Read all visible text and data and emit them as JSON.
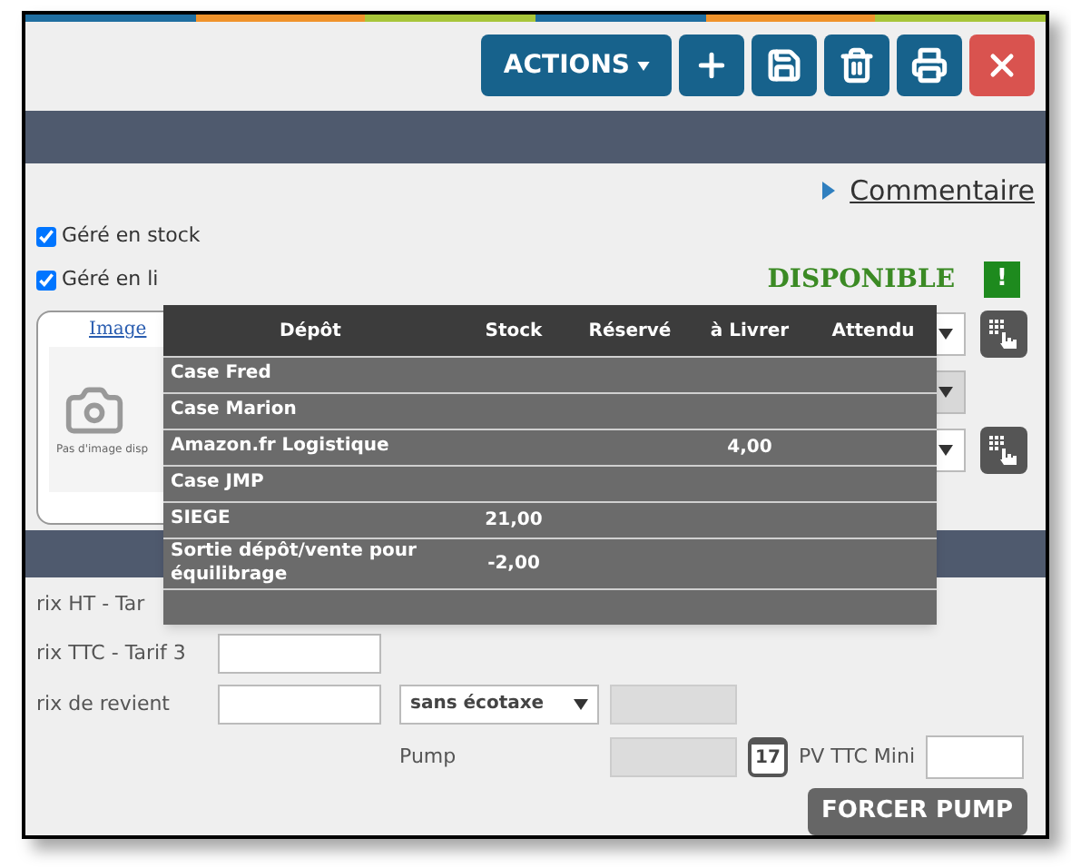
{
  "toolbar": {
    "actions_label": "ACTIONS",
    "buttons": [
      {
        "kind": "add"
      },
      {
        "kind": "save"
      },
      {
        "kind": "delete"
      },
      {
        "kind": "print"
      },
      {
        "kind": "close"
      }
    ]
  },
  "comment_link": "Commentaire",
  "checkboxes": [
    {
      "label": "Géré en stock",
      "checked": true
    },
    {
      "label": "Géré en li",
      "checked": true
    }
  ],
  "status": {
    "label": "DISPONIBLE",
    "alert": "!"
  },
  "image": {
    "link": "Image",
    "caption": "Pas d'image disp"
  },
  "selectors": [
    {
      "disabled": false
    },
    {
      "disabled": true
    },
    {
      "disabled": false
    }
  ],
  "stock_table": {
    "columns": [
      "Dépôt",
      "Stock",
      "Réservé",
      "à Livrer",
      "Attendu"
    ],
    "rows": [
      [
        "Case Fred",
        "",
        "",
        "",
        ""
      ],
      [
        "Case Marion",
        "",
        "",
        "",
        ""
      ],
      [
        "Amazon.fr Logistique",
        "",
        "",
        "4,00",
        ""
      ],
      [
        "Case JMP",
        "",
        "",
        "",
        ""
      ],
      [
        "SIEGE",
        "21,00",
        "",
        "",
        ""
      ],
      [
        "Sortie dépôt/vente pour équilibrage",
        "-2,00",
        "",
        "",
        ""
      ],
      [
        "",
        "",
        "",
        "",
        ""
      ]
    ]
  },
  "price_form": {
    "ht_label": "rix HT - Tar",
    "ttc_label": "rix TTC - Tarif 3",
    "cost_label": "rix de revient",
    "ecotax_select": "sans écotaxe",
    "pump_label": "Pump",
    "calendar_day": "17",
    "pv_min_label": "PV TTC Mini",
    "force_button": "FORCER PUMP"
  }
}
